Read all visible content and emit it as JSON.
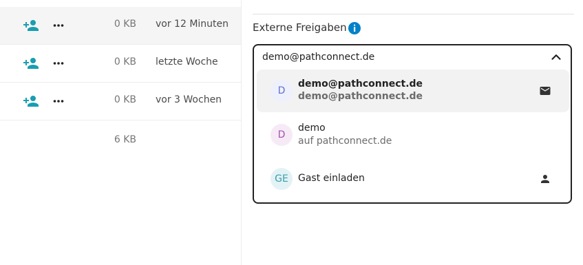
{
  "files": {
    "rows": [
      {
        "size": "0 KB",
        "modified": "vor 12 Minuten",
        "active": true
      },
      {
        "size": "0 KB",
        "modified": "letzte Woche",
        "active": false
      },
      {
        "size": "0 KB",
        "modified": "vor 3 Wochen",
        "active": false
      }
    ],
    "total_size": "6 KB",
    "icons": {
      "share": "add-user-icon",
      "more": "more-horizontal-icon"
    }
  },
  "sidebar": {
    "section_title": "Externe Freigaben",
    "info_icon": "info-icon",
    "search": {
      "value": "demo@pathconnect.de",
      "toggle_icon": "chevron-up-icon"
    },
    "options": [
      {
        "avatar_text": "D",
        "title": "demo@pathconnect.de",
        "subtitle": "demo@pathconnect.de",
        "icon": "email-icon",
        "highlighted": true
      },
      {
        "avatar_text": "D",
        "title": "demo",
        "subtitle": "auf pathconnect.de",
        "icon": "",
        "highlighted": false
      },
      {
        "avatar_text": "GE",
        "title": "Gast einladen",
        "subtitle": "",
        "icon": "person-icon",
        "highlighted": false
      }
    ]
  },
  "colors": {
    "accent": "#0082c9",
    "share_icon": "#1a9db0",
    "avatar_email_bg": "#eef0fb",
    "avatar_email_fg": "#6170c8",
    "avatar_user_bg": "#f6eaf7",
    "avatar_user_fg": "#a453b0",
    "avatar_guest_bg": "#e3f2f5",
    "avatar_guest_fg": "#3a9cad"
  }
}
